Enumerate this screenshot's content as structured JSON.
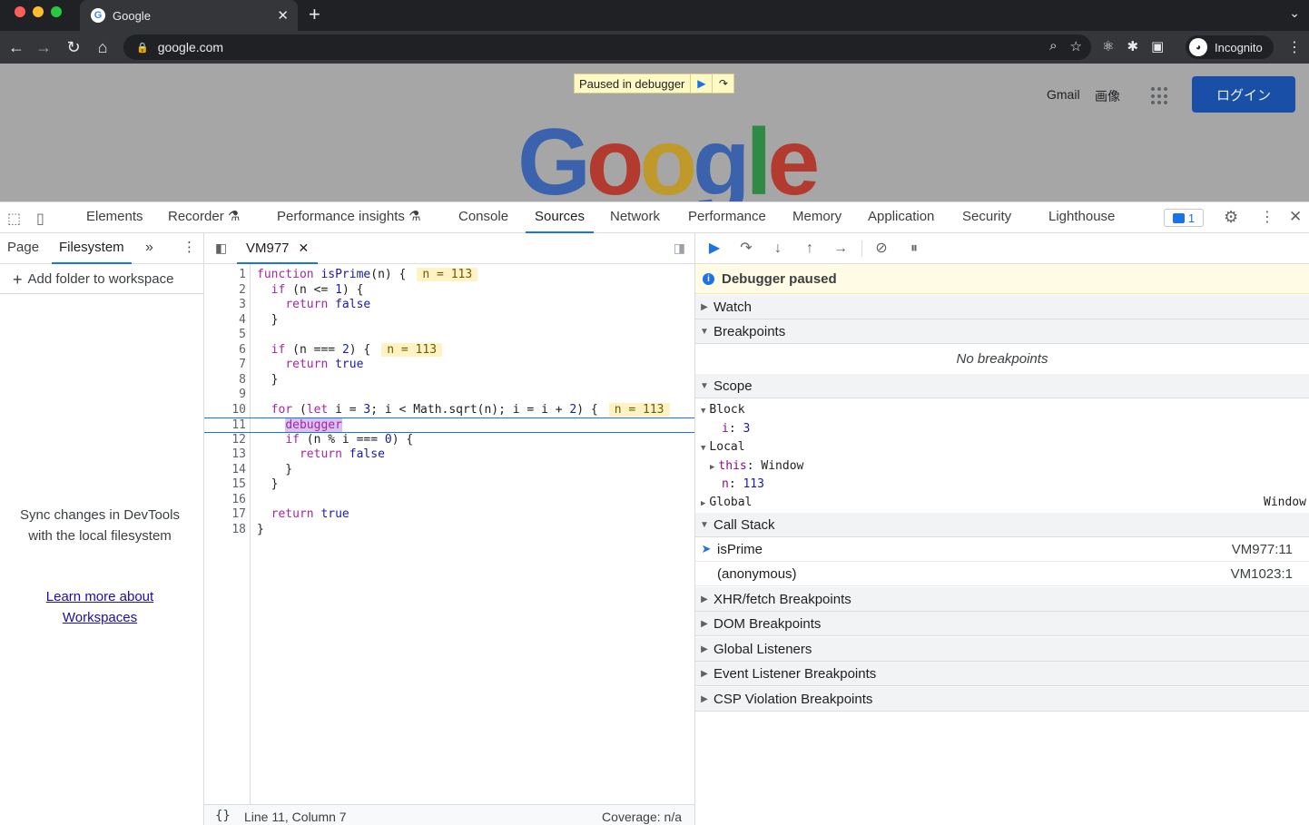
{
  "browser": {
    "tab_title": "Google",
    "favicon_letter": "G",
    "url": "google.com",
    "profile_label": "Incognito"
  },
  "page": {
    "paused_banner": "Paused in debugger",
    "gmail": "Gmail",
    "images": "画像",
    "login": "ログイン",
    "logo_letters": [
      "G",
      "o",
      "o",
      "g",
      "l",
      "e"
    ]
  },
  "devtools": {
    "tabs": [
      "Elements",
      "Recorder",
      "Performance insights",
      "Console",
      "Sources",
      "Network",
      "Performance",
      "Memory",
      "Application",
      "Security",
      "Lighthouse"
    ],
    "active_tab": "Sources",
    "issues_count": "1",
    "navigator": {
      "subtabs": [
        "Page",
        "Filesystem"
      ],
      "active_subtab": "Filesystem",
      "add_folder": "Add folder to workspace",
      "sync_text": "Sync changes in DevTools with the local filesystem",
      "learn_more": "Learn more about Workspaces"
    },
    "editor": {
      "file_tab": "VM977",
      "status_braces": "{}",
      "status_position": "Line 11, Column 7",
      "status_coverage": "Coverage: n/a",
      "line_numbers": [
        "1",
        "2",
        "3",
        "4",
        "5",
        "6",
        "7",
        "8",
        "9",
        "10",
        "11",
        "12",
        "13",
        "14",
        "15",
        "16",
        "17",
        "18"
      ],
      "inline_values": [
        "n = 113",
        "n = 113",
        "n = 113"
      ]
    },
    "debugger": {
      "paused_label": "Debugger paused",
      "watch": "Watch",
      "breakpoints": "Breakpoints",
      "no_breakpoints": "No breakpoints",
      "scope": "Scope",
      "scope_block": "Block",
      "scope_block_var": "i",
      "scope_block_val": "3",
      "scope_local": "Local",
      "scope_this": "this",
      "scope_this_val": "Window",
      "scope_local_var": "n",
      "scope_local_val": "113",
      "scope_global": "Global",
      "scope_global_val": "Window",
      "call_stack": "Call Stack",
      "frames": [
        {
          "name": "isPrime",
          "location": "VM977:11"
        },
        {
          "name": "(anonymous)",
          "location": "VM1023:1"
        }
      ],
      "more_sections": [
        "XHR/fetch Breakpoints",
        "DOM Breakpoints",
        "Global Listeners",
        "Event Listener Breakpoints",
        "CSP Violation Breakpoints"
      ]
    }
  }
}
